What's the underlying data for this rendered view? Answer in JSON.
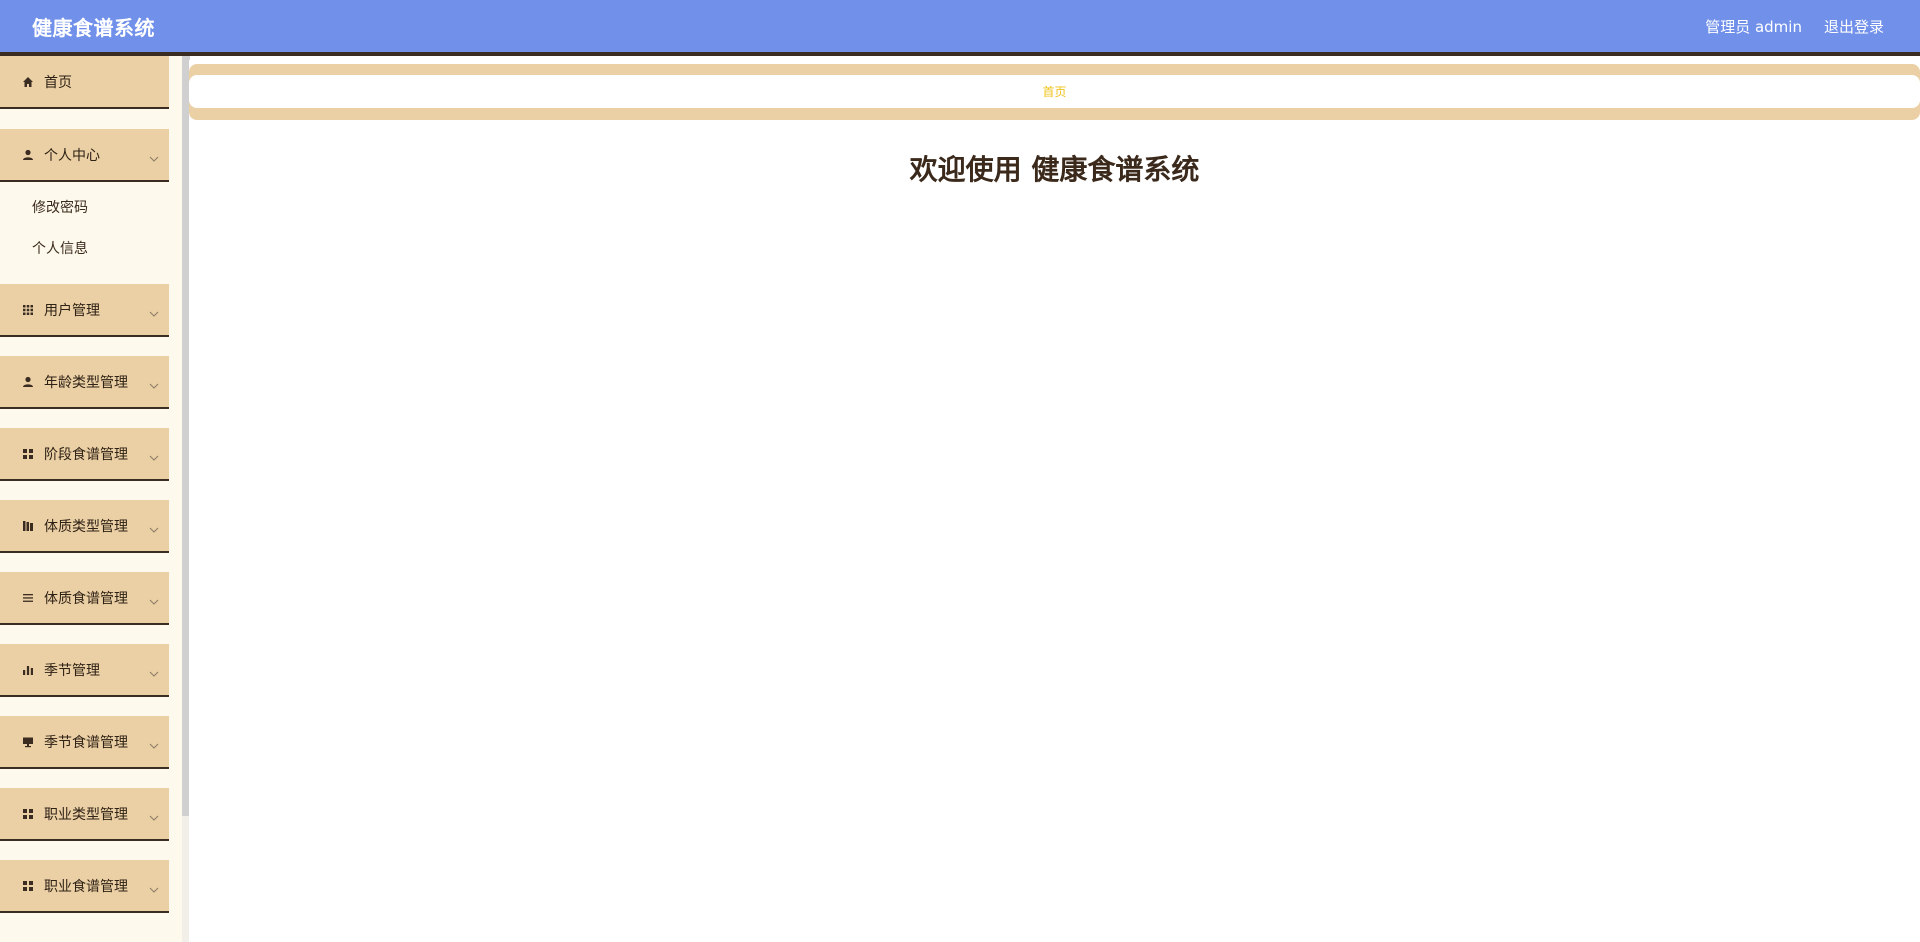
{
  "header": {
    "brand": "健康食谱系统",
    "user": "管理员 admin",
    "logout": "退出登录"
  },
  "sidebar": {
    "items": [
      {
        "label": "首页",
        "icon": "home-icon"
      },
      {
        "label": "个人中心",
        "icon": "user-icon",
        "sub": [
          "修改密码",
          "个人信息"
        ]
      },
      {
        "label": "用户管理",
        "icon": "grid-icon"
      },
      {
        "label": "年龄类型管理",
        "icon": "user-icon"
      },
      {
        "label": "阶段食谱管理",
        "icon": "apps-icon"
      },
      {
        "label": "体质类型管理",
        "icon": "books-icon"
      },
      {
        "label": "体质食谱管理",
        "icon": "list-icon"
      },
      {
        "label": "季节管理",
        "icon": "bar-chart-icon"
      },
      {
        "label": "季节食谱管理",
        "icon": "monitor-icon"
      },
      {
        "label": "职业类型管理",
        "icon": "apps-icon"
      },
      {
        "label": "职业食谱管理",
        "icon": "apps-icon"
      }
    ]
  },
  "breadcrumb": "首页",
  "welcome": "欢迎使用 健康食谱系统",
  "colors": {
    "header": "#7090ea",
    "menu": "#ebd0a5",
    "sidebar": "#fef9ed",
    "accent": "#f0c21a"
  }
}
